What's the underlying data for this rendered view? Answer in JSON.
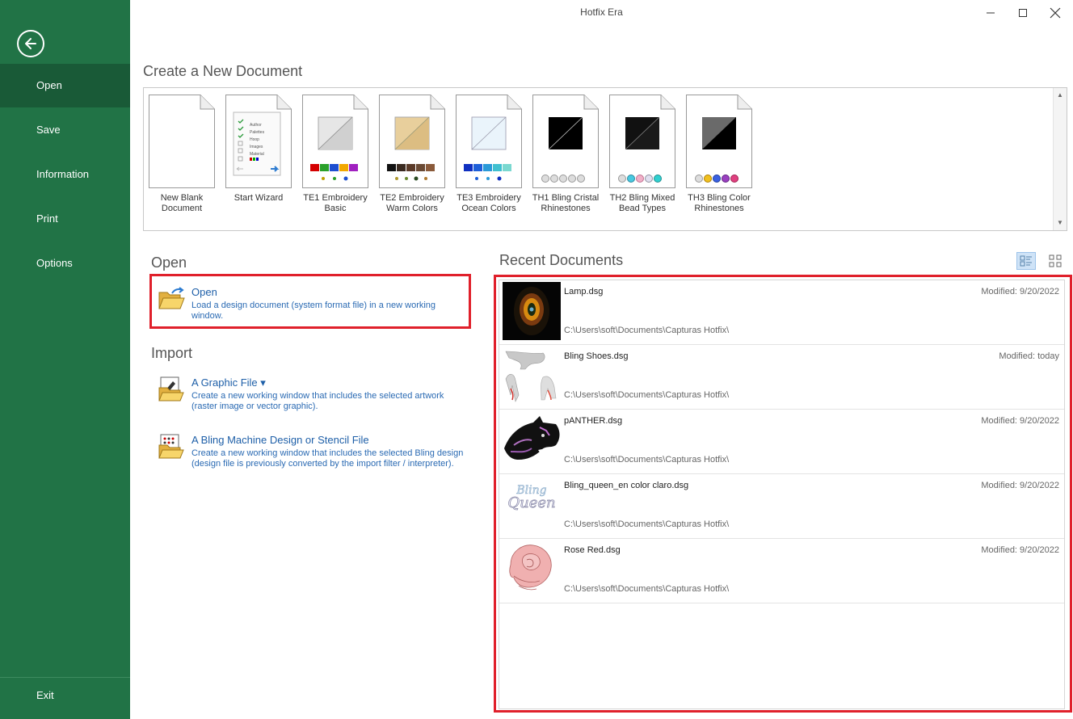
{
  "window": {
    "title": "Hotfix Era"
  },
  "sidebar": {
    "items": [
      {
        "label": "Open"
      },
      {
        "label": "Save"
      },
      {
        "label": "Information"
      },
      {
        "label": "Print"
      },
      {
        "label": "Options"
      }
    ],
    "exit_label": "Exit"
  },
  "create": {
    "heading": "Create a New Document",
    "templates": [
      {
        "label": "New Blank Document"
      },
      {
        "label": "Start Wizard",
        "wizard_items": [
          "Author",
          "Palettes",
          "Hoop",
          "Images",
          "Material"
        ]
      },
      {
        "label": "TE1 Embroidery Basic"
      },
      {
        "label": "TE2 Embroidery Warm Colors"
      },
      {
        "label": "TE3 Embroidery Ocean Colors"
      },
      {
        "label": "TH1 Bling Cristal Rhinestones"
      },
      {
        "label": "TH2 Bling Mixed Bead Types"
      },
      {
        "label": "TH3 Bling Color Rhinestones"
      }
    ]
  },
  "open": {
    "heading": "Open",
    "title": "Open",
    "desc": "Load a design document (system format file) in a new working window."
  },
  "import": {
    "heading": "Import",
    "graphic_title": "A Graphic File ▾",
    "graphic_desc": "Create a new working window that includes the selected artwork (raster image or vector graphic).",
    "bling_title": "A Bling Machine Design or Stencil File",
    "bling_desc": "Create a new working window that includes the selected Bling design (design file is previously converted by the import filter / interpreter)."
  },
  "recent": {
    "heading": "Recent Documents",
    "docs": [
      {
        "name": "Lamp.dsg",
        "modified": "Modified: 9/20/2022",
        "path": "C:\\Users\\soft\\Documents\\Capturas Hotfix\\"
      },
      {
        "name": "Bling Shoes.dsg",
        "modified": "Modified: today",
        "path": "C:\\Users\\soft\\Documents\\Capturas Hotfix\\"
      },
      {
        "name": "pANTHER.dsg",
        "modified": "Modified: 9/20/2022",
        "path": "C:\\Users\\soft\\Documents\\Capturas Hotfix\\"
      },
      {
        "name": "Bling_queen_en color claro.dsg",
        "modified": "Modified: 9/20/2022",
        "path": "C:\\Users\\soft\\Documents\\Capturas Hotfix\\"
      },
      {
        "name": "Rose Red.dsg",
        "modified": "Modified: 9/20/2022",
        "path": "C:\\Users\\soft\\Documents\\Capturas Hotfix\\"
      }
    ],
    "queen_logo_lines": [
      "Bling",
      "Queen"
    ]
  },
  "colors": {
    "sidebar": "#217346",
    "sidebar_active": "#195a37",
    "link": "#1e5fa8",
    "highlight": "#e0202b"
  }
}
